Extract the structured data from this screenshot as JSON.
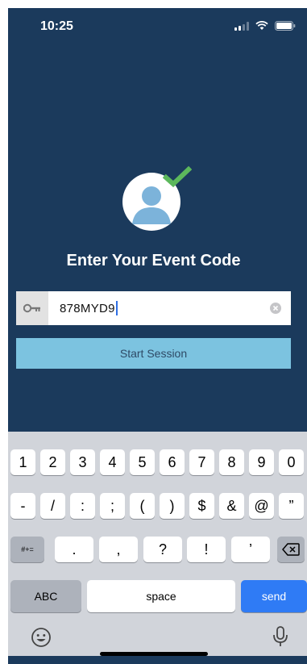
{
  "status": {
    "time": "10:25"
  },
  "colors": {
    "background": "#1b3a5c",
    "button": "#7cc3e0",
    "check": "#5cb85c",
    "avatar_figure": "#7cb3da",
    "send_key": "#2f7bf5"
  },
  "main": {
    "title": "Enter Your Event Code",
    "code_value": "878MYD9",
    "start_button_label": "Start Session"
  },
  "keyboard": {
    "row1": [
      "1",
      "2",
      "3",
      "4",
      "5",
      "6",
      "7",
      "8",
      "9",
      "0"
    ],
    "row2": [
      "-",
      "/",
      ":",
      ";",
      "(",
      ")",
      "$",
      "&",
      "@",
      "”"
    ],
    "row3_toggle": "#+=",
    "row3": [
      ".",
      ",",
      "?",
      "!",
      "’"
    ],
    "abc_label": "ABC",
    "space_label": "space",
    "send_label": "send"
  }
}
